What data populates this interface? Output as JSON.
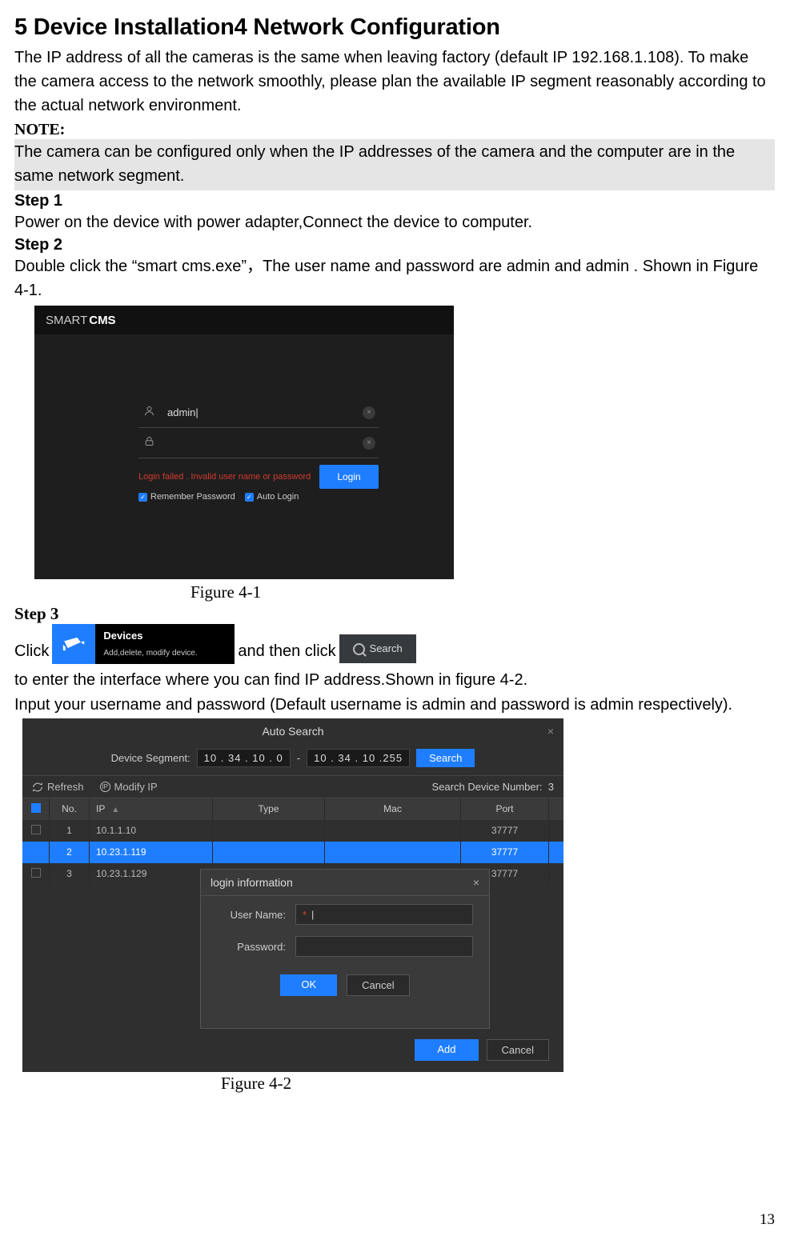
{
  "heading": "5  Device Installation4 Network Configuration",
  "intro": "The IP address of all the cameras is the same when leaving factory (default IP 192.168.1.108). To make the camera access to the network smoothly, please plan the available IP segment reasonably according to the actual network environment.",
  "note_label": "NOTE:",
  "note_text": "The camera can be configured only when the IP addresses of the camera and the computer are in the same network segment.",
  "step1_label": "Step 1",
  "step1_text": "Power on the device with power adapter,Connect the device to computer.",
  "step2_label": "Step 2",
  "step2_text": "Double click the “smart cms.exe”，The user name and password are admin and admin . Shown in Figure 4-1.",
  "fig1_caption": "Figure 4-1",
  "step3_label": "Step 3",
  "step3_click": "Click",
  "step3_then": " and then click ",
  "step3_rest": " to enter the interface where you can find IP address.Shown in figure 4-2.",
  "step3_input": "Input your username and password (Default username is admin and password is admin respectively).",
  "fig2_caption": "Figure 4-2",
  "page_num": "13",
  "shot1": {
    "brand_thin": "SMART",
    "brand_bold": " CMS",
    "username": "admin|",
    "error": "Login failed . Invalid user name or password",
    "login": "Login",
    "remember": "Remember Password",
    "auto": "Auto Login"
  },
  "devices": {
    "title": "Devices",
    "sub": "Add,delete, modify device."
  },
  "search_label": "Search",
  "shot2": {
    "title": "Auto Search",
    "segment_label": "Device Segment:",
    "ip_from": "10  . 34  . 10  .  0",
    "ip_to": "10  . 34  . 10 .255",
    "search": "Search",
    "refresh": "Refresh",
    "modify": "Modify IP",
    "count_label": "Search Device Number:",
    "count_val": "3",
    "headers": {
      "no": "No.",
      "ip": "IP",
      "type": "Type",
      "mac": "Mac",
      "port": "Port"
    },
    "rows": [
      {
        "no": "1",
        "ip": "10.1.1.10",
        "port": "37777",
        "selected": false
      },
      {
        "no": "2",
        "ip": "10.23.1.119",
        "port": "37777",
        "selected": true
      },
      {
        "no": "3",
        "ip": "10.23.1.129",
        "port": "37777",
        "selected": false
      }
    ],
    "login_modal": {
      "title": "login information",
      "user_label": "User Name:",
      "user_val": "|",
      "pass_label": "Password:",
      "ok": "OK",
      "cancel": "Cancel"
    },
    "add": "Add",
    "cancel": "Cancel"
  }
}
